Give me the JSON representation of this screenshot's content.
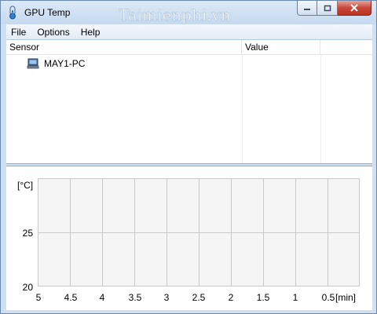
{
  "window": {
    "title": "GPU Temp",
    "watermark": "Taimienphi.vn"
  },
  "menu": {
    "items": [
      "File",
      "Options",
      "Help"
    ]
  },
  "sensors": {
    "columns": [
      "Sensor",
      "Value"
    ],
    "rows": [
      {
        "name": "MAY1-PC",
        "value": ""
      }
    ]
  },
  "graph": {
    "y_unit": "[°C]",
    "y_ticks": [
      "25",
      "20"
    ],
    "x_ticks": [
      "5",
      "4.5",
      "4",
      "3.5",
      "3",
      "2.5",
      "2",
      "1.5",
      "1",
      "0.5"
    ],
    "x_unit": "[min]",
    "vertical_gridlines": 10,
    "horizontal_gridlines": 2,
    "grid_color": "#c8c8c8",
    "plot_background": "#f5f5f5"
  },
  "colors": {
    "title_bar": "#cfe0f3",
    "close_button": "#c9483a"
  }
}
